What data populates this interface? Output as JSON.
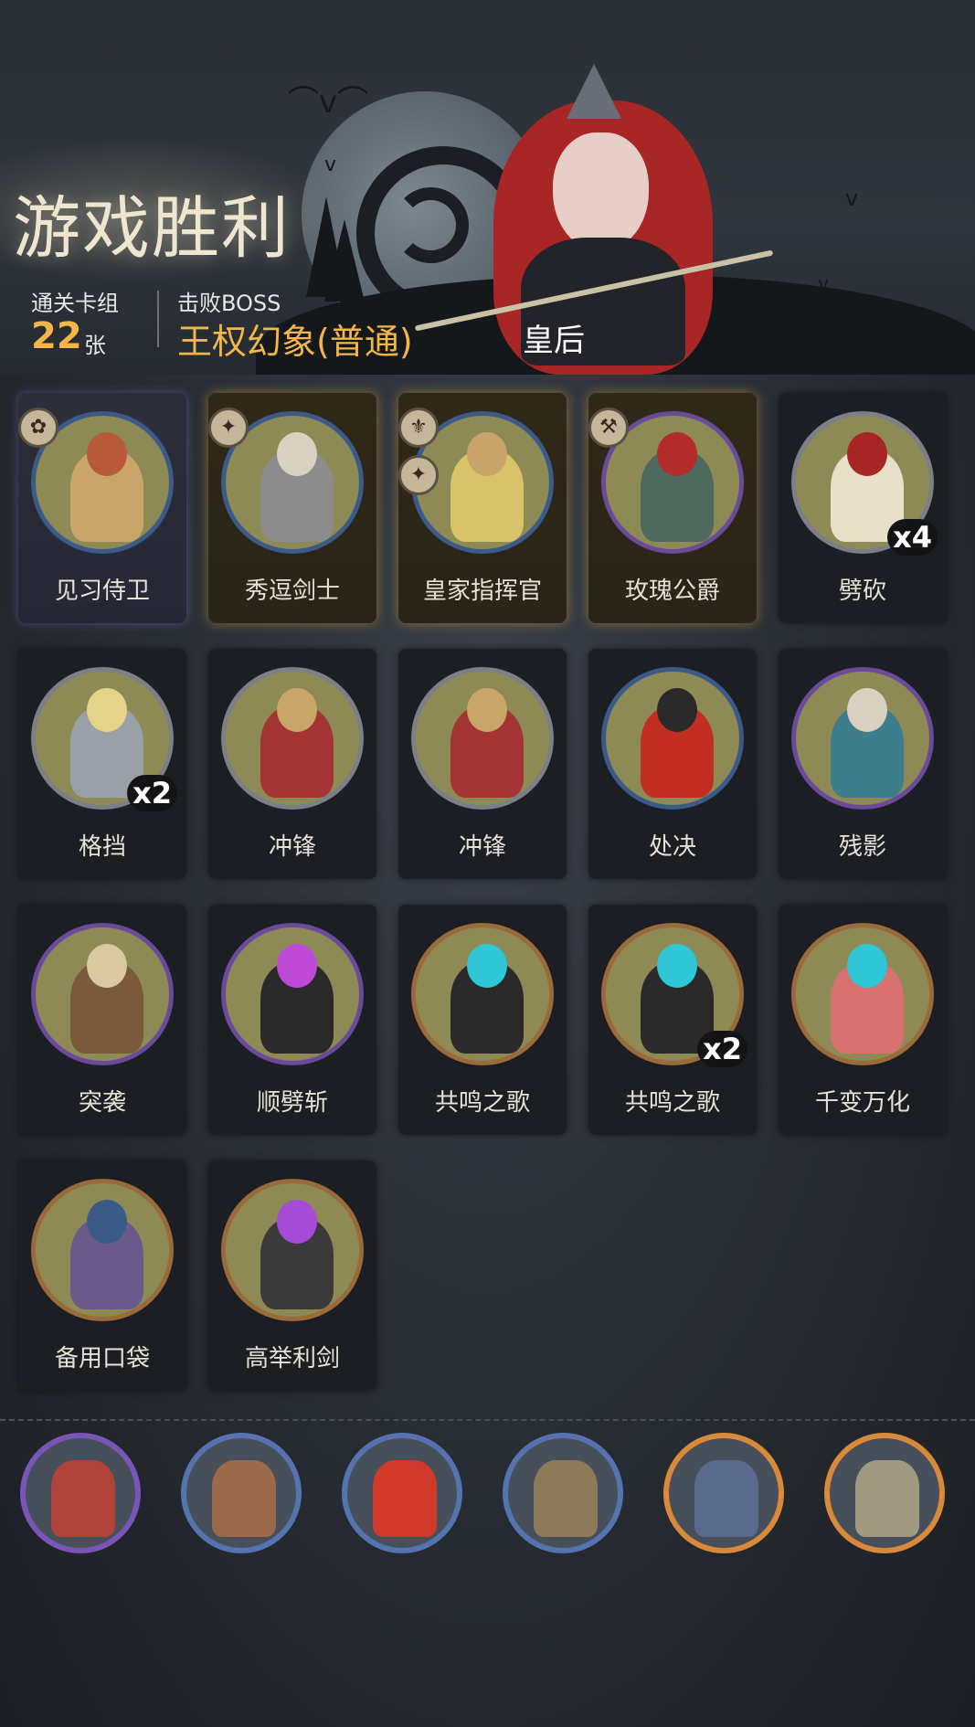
{
  "header": {
    "title": "游戏胜利",
    "stats": {
      "deck_label": "通关卡组",
      "deck_count": "22",
      "deck_unit": "张",
      "boss_label": "击败BOSS",
      "boss_name": "王权幻象(普通)",
      "boss_title": "皇后"
    }
  },
  "cards": [
    {
      "name": "见习侍卫",
      "frame": "purple",
      "ring": "blue",
      "badges": [
        "rose-icon"
      ],
      "count": ""
    },
    {
      "name": "秀逗剑士",
      "frame": "gold",
      "ring": "blue",
      "badges": [
        "raven-icon"
      ],
      "count": ""
    },
    {
      "name": "皇家指挥官",
      "frame": "gold",
      "ring": "blue",
      "badges": [
        "crest-icon",
        "raven-icon"
      ],
      "count": ""
    },
    {
      "name": "玫瑰公爵",
      "frame": "gold",
      "ring": "violet",
      "badges": [
        "axe-icon"
      ],
      "count": ""
    },
    {
      "name": "劈砍",
      "frame": "dark",
      "ring": "gray",
      "badges": [],
      "count": "x4"
    },
    {
      "name": "格挡",
      "frame": "dark",
      "ring": "gray",
      "badges": [],
      "count": "x2"
    },
    {
      "name": "冲锋",
      "frame": "dark",
      "ring": "gray",
      "badges": [],
      "count": ""
    },
    {
      "name": "冲锋",
      "frame": "dark",
      "ring": "gray",
      "badges": [],
      "count": ""
    },
    {
      "name": "处决",
      "frame": "dark",
      "ring": "blue",
      "badges": [],
      "count": ""
    },
    {
      "name": "残影",
      "frame": "dark",
      "ring": "violet",
      "badges": [],
      "count": ""
    },
    {
      "name": "突袭",
      "frame": "dark",
      "ring": "violet",
      "badges": [],
      "count": ""
    },
    {
      "name": "顺劈斩",
      "frame": "dark",
      "ring": "violet",
      "badges": [],
      "count": ""
    },
    {
      "name": "共鸣之歌",
      "frame": "dark",
      "ring": "brown",
      "badges": [],
      "count": ""
    },
    {
      "name": "共鸣之歌",
      "frame": "dark",
      "ring": "brown",
      "badges": [],
      "count": "x2"
    },
    {
      "name": "千变万化",
      "frame": "dark",
      "ring": "brown",
      "badges": [],
      "count": ""
    },
    {
      "name": "备用口袋",
      "frame": "dark",
      "ring": "brown",
      "badges": [],
      "count": ""
    },
    {
      "name": "高举利剑",
      "frame": "dark",
      "ring": "brown",
      "badges": [],
      "count": ""
    }
  ],
  "relics": [
    {
      "icon": "alley-relic-icon",
      "ring": "violet"
    },
    {
      "icon": "runner-relic-icon",
      "ring": "blue"
    },
    {
      "icon": "claw-relic-icon",
      "ring": "blue"
    },
    {
      "icon": "street-relic-icon",
      "ring": "blue"
    },
    {
      "icon": "knight-relic-icon",
      "ring": "orange"
    },
    {
      "icon": "catapult-relic-icon",
      "ring": "orange"
    }
  ],
  "colors": {
    "accent_gold": "#f2b649",
    "title_cream": "#efe6cf",
    "ring_blue": "#3c5a88",
    "ring_violet": "#6a4a99",
    "ring_brown": "#9a6a3a",
    "frame_gold_glow": "#dc9632",
    "frame_purple_glow": "#8278dc"
  }
}
